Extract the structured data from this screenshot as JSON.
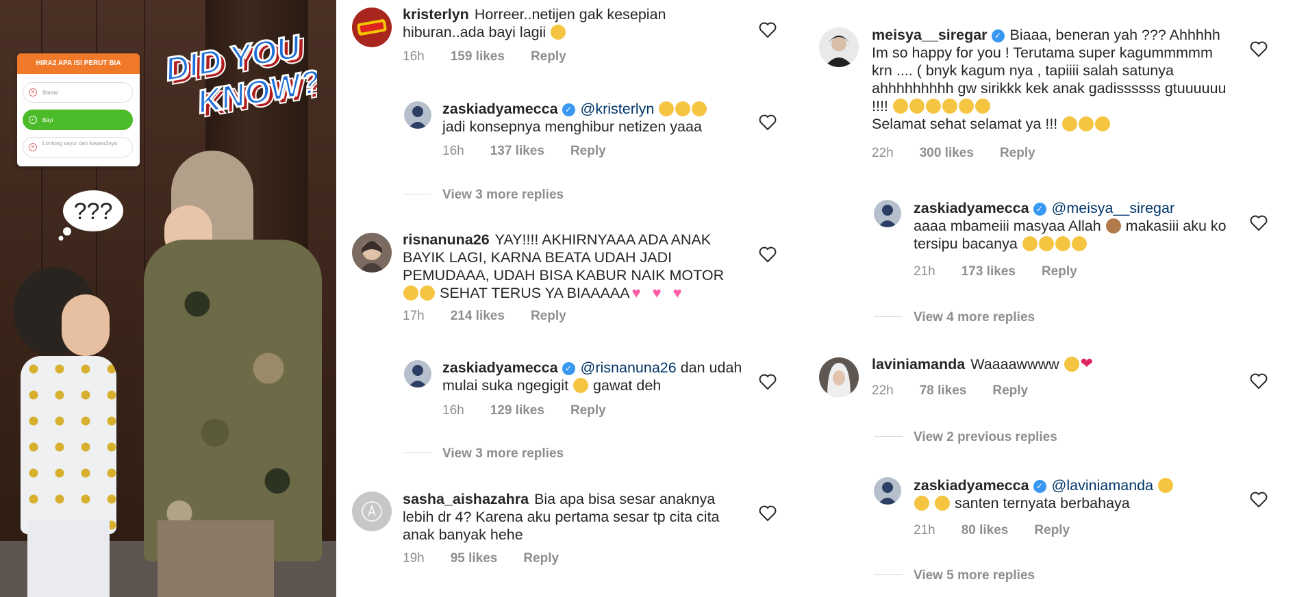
{
  "story": {
    "poll_title": "HIRA2 APA ISI PERUT BIA",
    "options": [
      {
        "label": "Bantal",
        "selected": false
      },
      {
        "label": "Bayi",
        "selected": true
      },
      {
        "label": "Lontong sayur dan kawan2nya",
        "selected": false
      }
    ],
    "sticker_line1": "DID YOU",
    "sticker_line2": "KNOW?",
    "thought": "???"
  },
  "col1": [
    {
      "type": "comment",
      "user": "kristerlyn",
      "text": "Horreer..netijen gak kesepian hiburan..ada bayi lagii",
      "emoji": "😍",
      "time": "16h",
      "likes": "159 likes",
      "reply": "Reply"
    },
    {
      "type": "reply",
      "user": "zaskiadyamecca",
      "mention": "@kristerlyn",
      "text": "jadi konsepnya menghibur netizen yaaa",
      "emoji": "😂😂😂",
      "time": "16h",
      "likes": "137 likes",
      "reply": "Reply"
    },
    {
      "type": "more",
      "label": "View 3 more replies"
    },
    {
      "type": "comment",
      "user": "risnanuna26",
      "text": "YAY!!!! AKHIRNYAAA ADA ANAK BAYIK LAGI, KARNA BEATA UDAH JADI PEMUDAAA, UDAH BISA KABUR NAIK MOTOR",
      "text2": "SEHAT TERUS YA BIAAAAA",
      "time": "17h",
      "likes": "214 likes",
      "reply": "Reply"
    },
    {
      "type": "reply",
      "user": "zaskiadyamecca",
      "mention": "@risnanuna26",
      "text": "dan udah mulai suka ngegigit",
      "text2": "gawat deh",
      "time": "16h",
      "likes": "129 likes",
      "reply": "Reply"
    },
    {
      "type": "more",
      "label": "View 3 more replies"
    },
    {
      "type": "comment",
      "user": "sasha_aishazahra",
      "text": "Bia apa bisa sesar anaknya lebih dr 4? Karena aku pertama sesar tp cita cita anak banyak hehe",
      "time": "19h",
      "likes": "95 likes",
      "reply": "Reply"
    }
  ],
  "col2": [
    {
      "type": "comment",
      "user": "meisya__siregar",
      "text": "Biaaa, beneran yah ??? Ahhhhh Im so happy for you ! Terutama super kagummmmm krn .... ( bnyk kagum nya , tapiiii salah satunya ahhhhhhhhh gw sirikkk kek anak gadissssss gtuuuuuu !!!!",
      "text2": "Selamat sehat selamat ya !!!",
      "time": "22h",
      "likes": "300 likes",
      "reply": "Reply"
    },
    {
      "type": "reply",
      "user": "zaskiadyamecca",
      "mention": "@meisya__siregar",
      "text": "aaaa mbameiii masyaa Allah",
      "text2": "makasiii aku ko tersipu bacanya",
      "time": "21h",
      "likes": "173 likes",
      "reply": "Reply"
    },
    {
      "type": "more",
      "label": "View 4 more replies"
    },
    {
      "type": "comment",
      "user": "laviniamanda",
      "text": "Waaaawwww",
      "time": "22h",
      "likes": "78 likes",
      "reply": "Reply"
    },
    {
      "type": "more",
      "label": "View 2 previous replies"
    },
    {
      "type": "reply",
      "user": "zaskiadyamecca",
      "mention": "@laviniamanda",
      "text": "santen ternyata berbahaya",
      "time": "21h",
      "likes": "80 likes",
      "reply": "Reply"
    },
    {
      "type": "more",
      "label": "View 5 more replies"
    }
  ],
  "colors": {
    "verified": "#3897f0",
    "mention": "#003569",
    "meta": "#8e8e8e",
    "poll_header": "#f07a2a",
    "poll_selected": "#4cbb2a"
  }
}
